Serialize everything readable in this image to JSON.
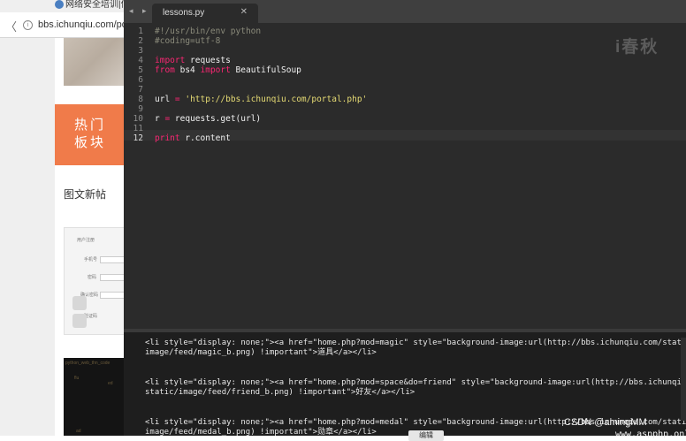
{
  "browser": {
    "tab_title": "网络安全培训|信息",
    "url": "bbs.ichunqiu.com/porta",
    "hot_block_label": "热门\n板块",
    "section_title": "图文新帖",
    "form_labels": [
      "用户注册",
      "手机号",
      "密码",
      "确认密码",
      "验证码"
    ],
    "dark_thumb_texts": [
      "python_web_thn_code",
      "flu",
      "ed",
      "ad"
    ]
  },
  "editor": {
    "tab_name": "lessons.py",
    "tab_close": "✕",
    "tab_arrows": "◂ ▸",
    "watermark": "i春秋",
    "current_line": 12,
    "line_numbers": [
      "1",
      "2",
      "3",
      "4",
      "5",
      "6",
      "7",
      "8",
      "9",
      "10",
      "11",
      "12"
    ],
    "lines": [
      [
        {
          "t": "#!/usr/bin/env python",
          "c": "cm"
        }
      ],
      [
        {
          "t": "#coding=utf-8",
          "c": "cm"
        }
      ],
      [],
      [
        {
          "t": "import",
          "c": "kw"
        },
        {
          "t": " requests",
          "c": ""
        }
      ],
      [
        {
          "t": "from",
          "c": "kw"
        },
        {
          "t": " bs4 ",
          "c": ""
        },
        {
          "t": "import",
          "c": "kw"
        },
        {
          "t": " BeautifulSoup",
          "c": ""
        }
      ],
      [],
      [],
      [
        {
          "t": "url ",
          "c": ""
        },
        {
          "t": "=",
          "c": "op"
        },
        {
          "t": " ",
          "c": ""
        },
        {
          "t": "'http://bbs.ichunqiu.com/portal.php'",
          "c": "st"
        }
      ],
      [],
      [
        {
          "t": "r ",
          "c": ""
        },
        {
          "t": "=",
          "c": "op"
        },
        {
          "t": " requests.get(url)",
          "c": ""
        }
      ],
      [],
      [
        {
          "t": "print",
          "c": "kw"
        },
        {
          "t": " r.content",
          "c": ""
        }
      ]
    ]
  },
  "console": {
    "lines": [
      "<li style=\"display: none;\"><a href=\"home.php?mod=magic\" style=\"background-image:url(http://bbs.ichunqiu.com/static/",
      "image/feed/magic_b.png) !important\">道具</a></li>",
      "",
      "",
      "<li style=\"display: none;\"><a href=\"home.php?mod=space&do=friend\" style=\"background-image:url(http://bbs.ichunqiu.com/",
      "static/image/feed/friend_b.png) !important\">好友</a></li>",
      "",
      "",
      "<li style=\"display: none;\"><a href=\"home.php?mod=medal\" style=\"background-image:url(http://bbs.ichunqiu.com/static/",
      "image/feed/medal_b.png) !important\">勋章</a></li>"
    ],
    "popup_button": "编辑",
    "credit_csdn": "CSDN @amingMM",
    "credit_site": "www.aspphp.online"
  }
}
